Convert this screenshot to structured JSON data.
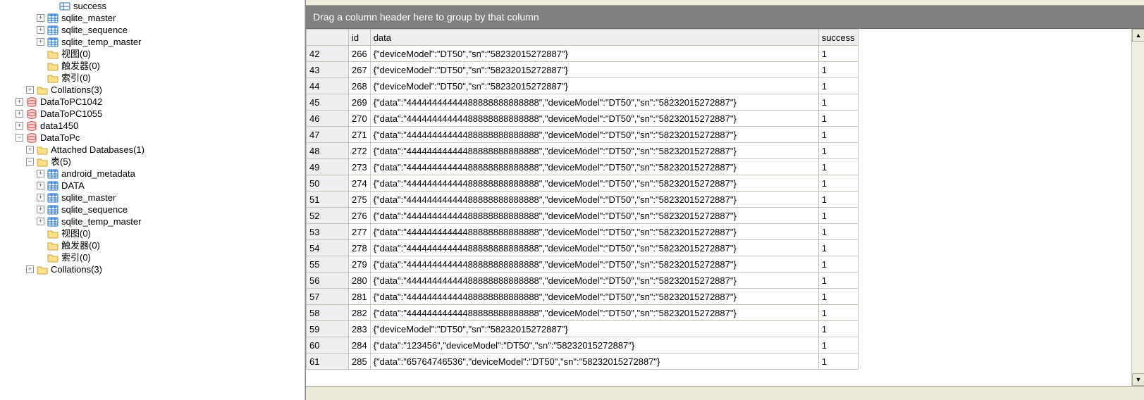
{
  "tree": {
    "success": "success",
    "sqlite_master": "sqlite_master",
    "sqlite_sequence": "sqlite_sequence",
    "sqlite_temp_master": "sqlite_temp_master",
    "views0": "视图(0)",
    "triggers0": "触发器(0)",
    "indexes0": "索引(0)",
    "collations3": "Collations(3)",
    "DataToPC1042": "DataToPC1042",
    "DataToPC1055": "DataToPC1055",
    "data1450": "data1450",
    "DataToPc": "DataToPc",
    "attachedDb1": "Attached Databases(1)",
    "tables5": "表(5)",
    "android_metadata": "android_metadata",
    "DATA": "DATA"
  },
  "toggle": {
    "plus": "+",
    "minus": "−"
  },
  "grid": {
    "hint": "Drag a column header here to group by that column",
    "headers": {
      "rowhead": "",
      "id": "id",
      "data": "data",
      "success": "success"
    },
    "rows": [
      {
        "n": "42",
        "id": "266",
        "data": "{\"deviceModel\":\"DT50\",\"sn\":\"58232015272887\"}",
        "success": "1"
      },
      {
        "n": "43",
        "id": "267",
        "data": "{\"deviceModel\":\"DT50\",\"sn\":\"58232015272887\"}",
        "success": "1"
      },
      {
        "n": "44",
        "id": "268",
        "data": "{\"deviceModel\":\"DT50\",\"sn\":\"58232015272887\"}",
        "success": "1"
      },
      {
        "n": "45",
        "id": "269",
        "data": "{\"data\":\"44444444444488888888888888\",\"deviceModel\":\"DT50\",\"sn\":\"58232015272887\"}",
        "success": "1"
      },
      {
        "n": "46",
        "id": "270",
        "data": "{\"data\":\"44444444444488888888888888\",\"deviceModel\":\"DT50\",\"sn\":\"58232015272887\"}",
        "success": "1"
      },
      {
        "n": "47",
        "id": "271",
        "data": "{\"data\":\"44444444444488888888888888\",\"deviceModel\":\"DT50\",\"sn\":\"58232015272887\"}",
        "success": "1"
      },
      {
        "n": "48",
        "id": "272",
        "data": "{\"data\":\"44444444444488888888888888\",\"deviceModel\":\"DT50\",\"sn\":\"58232015272887\"}",
        "success": "1"
      },
      {
        "n": "49",
        "id": "273",
        "data": "{\"data\":\"44444444444488888888888888\",\"deviceModel\":\"DT50\",\"sn\":\"58232015272887\"}",
        "success": "1"
      },
      {
        "n": "50",
        "id": "274",
        "data": "{\"data\":\"44444444444488888888888888\",\"deviceModel\":\"DT50\",\"sn\":\"58232015272887\"}",
        "success": "1"
      },
      {
        "n": "51",
        "id": "275",
        "data": "{\"data\":\"44444444444488888888888888\",\"deviceModel\":\"DT50\",\"sn\":\"58232015272887\"}",
        "success": "1"
      },
      {
        "n": "52",
        "id": "276",
        "data": "{\"data\":\"44444444444488888888888888\",\"deviceModel\":\"DT50\",\"sn\":\"58232015272887\"}",
        "success": "1"
      },
      {
        "n": "53",
        "id": "277",
        "data": "{\"data\":\"44444444444488888888888888\",\"deviceModel\":\"DT50\",\"sn\":\"58232015272887\"}",
        "success": "1"
      },
      {
        "n": "54",
        "id": "278",
        "data": "{\"data\":\"44444444444488888888888888\",\"deviceModel\":\"DT50\",\"sn\":\"58232015272887\"}",
        "success": "1"
      },
      {
        "n": "55",
        "id": "279",
        "data": "{\"data\":\"44444444444488888888888888\",\"deviceModel\":\"DT50\",\"sn\":\"58232015272887\"}",
        "success": "1"
      },
      {
        "n": "56",
        "id": "280",
        "data": "{\"data\":\"44444444444488888888888888\",\"deviceModel\":\"DT50\",\"sn\":\"58232015272887\"}",
        "success": "1"
      },
      {
        "n": "57",
        "id": "281",
        "data": "{\"data\":\"44444444444488888888888888\",\"deviceModel\":\"DT50\",\"sn\":\"58232015272887\"}",
        "success": "1"
      },
      {
        "n": "58",
        "id": "282",
        "data": "{\"data\":\"44444444444488888888888888\",\"deviceModel\":\"DT50\",\"sn\":\"58232015272887\"}",
        "success": "1"
      },
      {
        "n": "59",
        "id": "283",
        "data": "{\"deviceModel\":\"DT50\",\"sn\":\"58232015272887\"}",
        "success": "1"
      },
      {
        "n": "60",
        "id": "284",
        "data": "{\"data\":\"123456\",\"deviceModel\":\"DT50\",\"sn\":\"58232015272887\"}",
        "success": "1"
      },
      {
        "n": "61",
        "id": "285",
        "data": "{\"data\":\"65764746536\",\"deviceModel\":\"DT50\",\"sn\":\"58232015272887\"}",
        "success": "1"
      }
    ]
  }
}
